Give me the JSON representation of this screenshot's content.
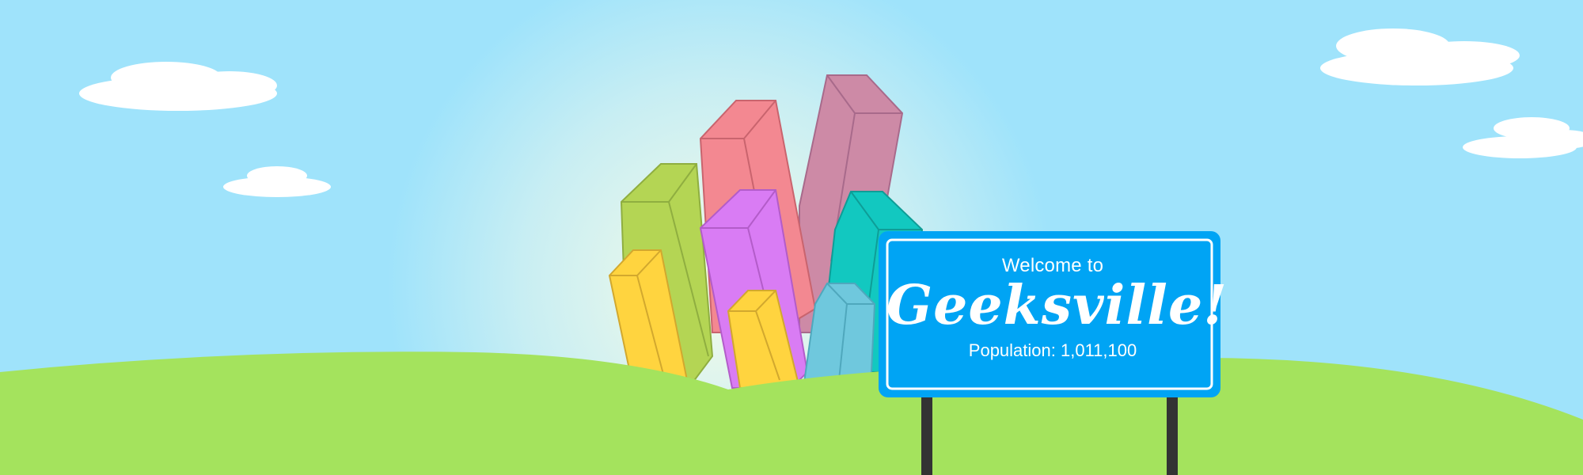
{
  "sign": {
    "welcome_line": "Welcome to",
    "town_name": "Geeksville!",
    "population_line": "Population: 1,011,100"
  },
  "colors": {
    "sky": "#9fe3fb",
    "sky_glow": "#eaf8e8",
    "grass": "#a4e35d",
    "cloud": "#ffffff",
    "sign_outer": "#00a4f4",
    "sign_inner_border": "#ffffff",
    "sign_post": "#333333",
    "building_colors": [
      "#ffd43f",
      "#b4d554",
      "#f38891",
      "#cd8aa6",
      "#d97cf4",
      "#12c8c0",
      "#6fc8dd"
    ]
  },
  "icons": [
    "cloud-icon",
    "building-icon",
    "sign-post-icon"
  ]
}
